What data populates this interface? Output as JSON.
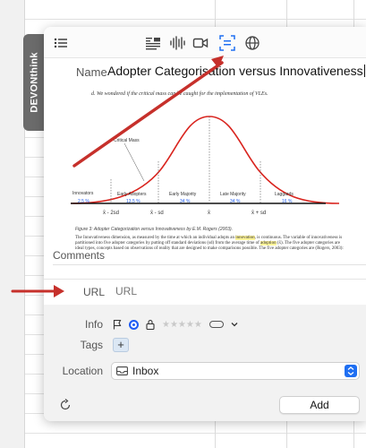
{
  "side_tab": {
    "label": "DEVONthink"
  },
  "name_row": {
    "label": "Name",
    "value": "Adopter Categorisation versus Innovativeness"
  },
  "preview": {
    "heading": "d.   We wondered if the critical mass can be caught for the implementation of VLEs.",
    "curve_labels": {
      "critical_mass": "Critical Mass",
      "innovators": "Innovators",
      "innovators_pct": "2.5 %",
      "early_adopters": "Early Adopters",
      "early_adopters_pct": "13.5 %",
      "early_majority": "Early Majority",
      "early_majority_pct": "34 %",
      "late_majority": "Late Majority",
      "late_majority_pct": "34 %",
      "laggards": "Laggards",
      "laggards_pct": "16 %",
      "x_minus_2sd": "x̄ - 2sd",
      "x_minus_sd": "x̄ - sd",
      "x_bar": "x̄",
      "x_plus_sd": "x̄ + sd"
    },
    "caption": "Figure 3: Adopter Categorization versus Innovativeness by E.M. Rogers (2003).",
    "body_before": "The Innovativeness dimension, as measured by the time at which an individual adopts an ",
    "body_hl1": "innovation",
    "body_mid": ", is continuous. The variable of innovativeness is partitioned into five adopter categories by putting off standard deviations (sd) from the average time of ",
    "body_hl2": "adoption",
    "body_after": " (x̄). The five adopter categories are ideal types, concepts based on observations of reality that are designed to make comparisons possible. The five adopter categories are (Rogers, 2003):"
  },
  "comments": {
    "label": "Comments"
  },
  "url": {
    "label": "URL",
    "placeholder": "URL"
  },
  "info": {
    "label": "Info"
  },
  "tags": {
    "label": "Tags",
    "add_symbol": "+"
  },
  "location": {
    "label": "Location",
    "value": "Inbox"
  },
  "actions": {
    "add_label": "Add"
  },
  "colors": {
    "accent": "#1f6ff2",
    "arrow": "#c6302b",
    "curve": "#d9241e",
    "label_blue": "#1f5cf4"
  }
}
